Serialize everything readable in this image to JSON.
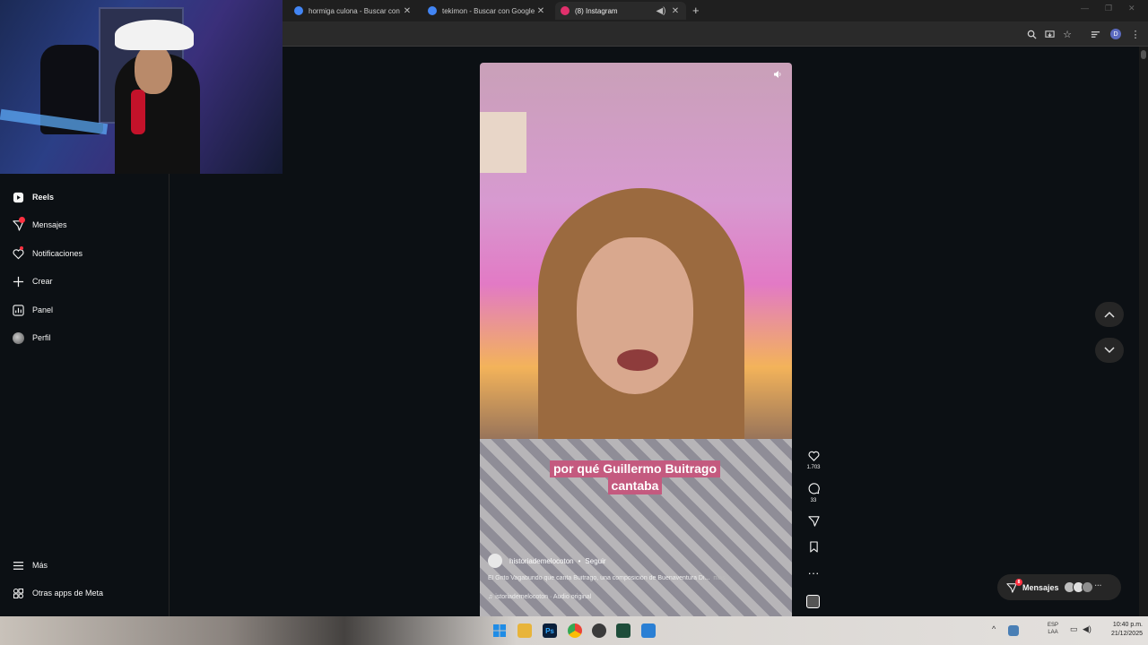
{
  "browser": {
    "tabs": [
      {
        "title": "hormiga culona - Buscar con G",
        "favicon_color": "#4285f4"
      },
      {
        "title": "tekimon - Buscar con Google",
        "favicon_color": "#4285f4"
      },
      {
        "title": "(8) Instagram",
        "favicon_color": "#e1306c",
        "active": true
      }
    ],
    "new_tab": "+",
    "toolbar_icons": [
      "zoom-icon",
      "install-icon",
      "bookmark-star-icon",
      "tab-search-icon",
      "profile-icon",
      "menu-icon"
    ],
    "profile_initial": "D"
  },
  "sidebar": {
    "items": [
      {
        "label": "Reels",
        "icon": "reels-icon",
        "bold": true
      },
      {
        "label": "Mensajes",
        "icon": "messages-icon",
        "badge": true
      },
      {
        "label": "Notificaciones",
        "icon": "heart-icon",
        "badge": true
      },
      {
        "label": "Crear",
        "icon": "plus-icon"
      },
      {
        "label": "Panel",
        "icon": "dashboard-icon"
      },
      {
        "label": "Perfil",
        "icon": "profile-avatar-icon"
      }
    ],
    "bottom_items": [
      {
        "label": "Más",
        "icon": "hamburger-icon"
      },
      {
        "label": "Otras apps de Meta",
        "icon": "meta-apps-icon"
      }
    ]
  },
  "reel": {
    "caption_overlay_line1": "por qué Guillermo Buitrago",
    "caption_overlay_line2": "cantaba",
    "author": "historiademelocoton",
    "follow": "Seguir",
    "description": "El Grito Vagabundo que canta Buitrago, una composición de Buenaventura Di...",
    "more": "más",
    "audio": "istoriademelocoton · Audio original",
    "likes": "1.703",
    "comments": "33"
  },
  "messages_pill": {
    "label": "Mensajes",
    "badge_count": "8"
  },
  "taskbar": {
    "language_line1": "ESP",
    "language_line2": "LAA",
    "time": "10:40 p.m.",
    "date": "21/12/2025"
  },
  "colors": {
    "instagram_bg": "#0c1014",
    "badge_red": "#ff3040",
    "caption_pink": "#c45a7f"
  }
}
